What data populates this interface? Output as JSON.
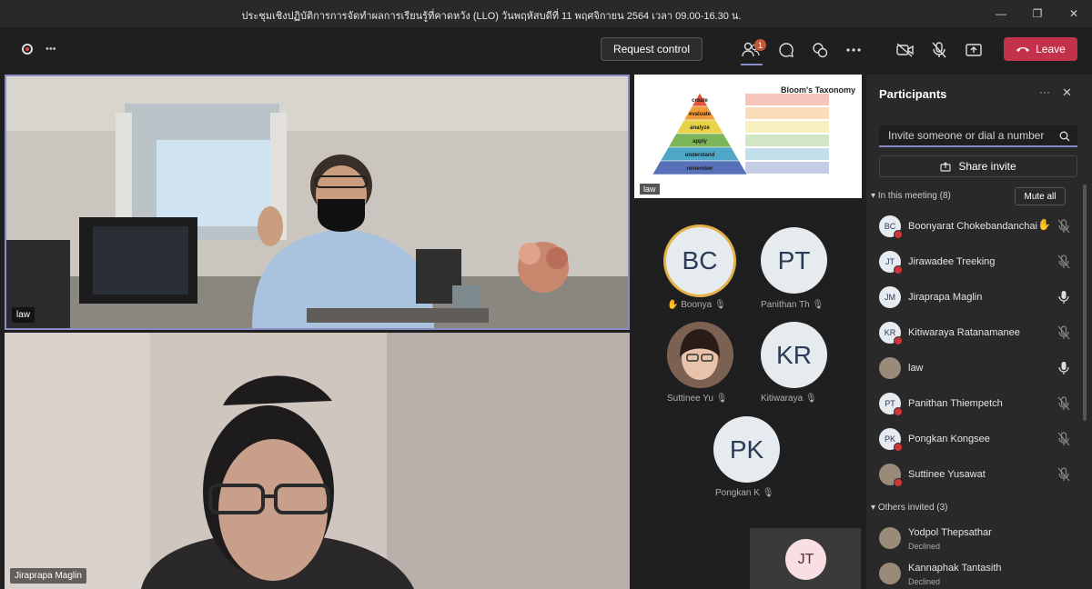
{
  "window": {
    "title": "ประชุมเชิงปฏิบัติการการจัดทำผลการเรียนรู้ที่คาดหวัง (LLO) วันพฤหัสบดีที่ 11 พฤศจิกายน 2564 เวลา 09.00-16.30 น.",
    "min_glyph": "—",
    "max_glyph": "❐",
    "close_glyph": "✕"
  },
  "toolbar": {
    "request_control_label": "Request control",
    "participants_badge": "1",
    "leave_label": "Leave"
  },
  "stage": {
    "tile1_name": "law",
    "tile2_name": "Jiraprapa Maglin",
    "share_name": "law"
  },
  "slide": {
    "title": "Bloom's Taxonomy",
    "levels": [
      "create",
      "evaluate",
      "analyze",
      "apply",
      "understand",
      "remember"
    ],
    "level_colors": [
      "#e2553a",
      "#f19a3a",
      "#e8d24a",
      "#7cb65a",
      "#4fa7c7",
      "#5870b8"
    ]
  },
  "gallery": [
    {
      "initials": "BC",
      "name": "Boonya",
      "hand": true
    },
    {
      "initials": "PT",
      "name": "Panithan Th"
    },
    {
      "initials": "",
      "name": "Suttinee Yu"
    },
    {
      "initials": "KR",
      "name": "Kitiwaraya"
    },
    {
      "initials": "PK",
      "name": "Pongkan K"
    },
    {
      "initials": "JT",
      "name": ""
    }
  ],
  "panel": {
    "title": "Participants",
    "invite_placeholder": "Invite someone or dial a number",
    "share_invite_label": "Share invite",
    "in_meeting_label": "In this meeting (8)",
    "mute_all_label": "Mute all",
    "others_label": "Others invited (3)",
    "in_meeting": [
      {
        "initials": "BC",
        "name": "Boonyarat Chokebandanchai",
        "mic": "muted",
        "hand": true
      },
      {
        "initials": "JT",
        "name": "Jirawadee Treeking",
        "mic": "muted"
      },
      {
        "initials": "JM",
        "name": "Jiraprapa Maglin",
        "mic": "on"
      },
      {
        "initials": "KR",
        "name": "Kitiwaraya Ratanamanee",
        "mic": "muted"
      },
      {
        "initials": "",
        "name": "law",
        "mic": "on"
      },
      {
        "initials": "PT",
        "name": "Panithan Thiempetch",
        "mic": "muted"
      },
      {
        "initials": "PK",
        "name": "Pongkan Kongsee",
        "mic": "muted"
      },
      {
        "initials": "",
        "name": "Suttinee Yusawat",
        "mic": "muted"
      }
    ],
    "others": [
      {
        "name": "Yodpol Thepsathar",
        "status": "Declined"
      },
      {
        "name": "Kannaphak Tantasith",
        "status": "Declined"
      }
    ]
  }
}
